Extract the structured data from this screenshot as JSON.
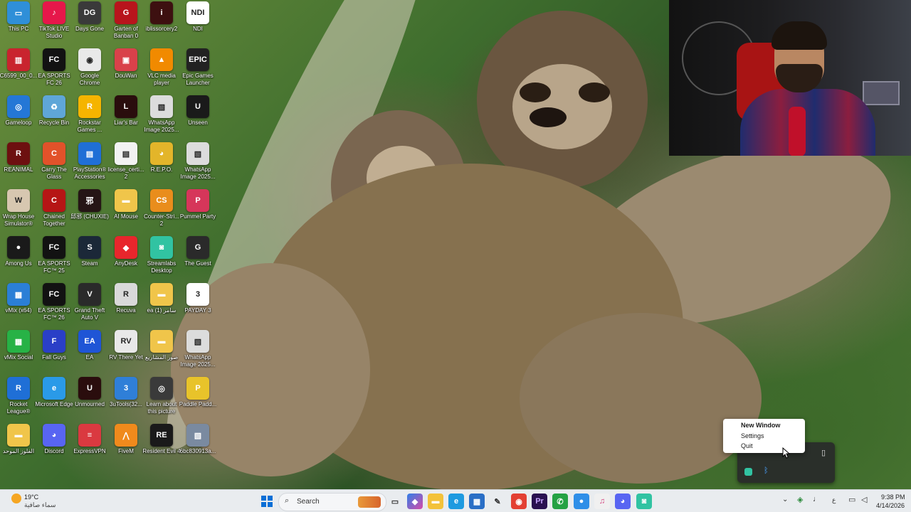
{
  "desktop": {
    "icons": [
      {
        "label": "This PC",
        "color": "#2f8fd8",
        "glyph": "▭",
        "icon": "pc-icon"
      },
      {
        "label": "TikTok LIVE Studio",
        "color": "#e6174a",
        "glyph": "♪",
        "icon": "tiktok-icon"
      },
      {
        "label": "Days Gone",
        "color": "#3a3a3a",
        "glyph": "DG",
        "icon": "game-icon"
      },
      {
        "label": "Garten of Banban 0",
        "color": "#b8141c",
        "glyph": "G",
        "icon": "game-icon"
      },
      {
        "label": "iblissorcery2",
        "color": "#3d1010",
        "glyph": "i",
        "icon": "game-icon"
      },
      {
        "label": "NDI",
        "color": "#ffffff",
        "glyph": "NDI",
        "icon": "ndi-icon"
      },
      {
        "label": "C6599_00_0...",
        "color": "#c9242e",
        "glyph": "▥",
        "icon": "file-icon"
      },
      {
        "label": "EA SPORTS FC 26",
        "color": "#121212",
        "glyph": "FC",
        "icon": "game-icon"
      },
      {
        "label": "Google Chrome",
        "color": "#e9e9e9",
        "glyph": "◉",
        "icon": "chrome-icon"
      },
      {
        "label": "DouWan",
        "color": "#d9414a",
        "glyph": "▣",
        "icon": "app-icon"
      },
      {
        "label": "VLC media player",
        "color": "#f18a00",
        "glyph": "▲",
        "icon": "vlc-icon"
      },
      {
        "label": "Epic Games Launcher",
        "color": "#222222",
        "glyph": "EPIC",
        "icon": "epic-icon"
      },
      {
        "label": "Gameloop",
        "color": "#2477d6",
        "glyph": "◎",
        "icon": "app-icon"
      },
      {
        "label": "Recycle Bin",
        "color": "#5fa6d8",
        "glyph": "♻",
        "icon": "recycle-bin-icon"
      },
      {
        "label": "Rockstar Games ...",
        "color": "#f5b400",
        "glyph": "R",
        "icon": "rockstar-icon"
      },
      {
        "label": "Liar's Bar",
        "color": "#2a0d0d",
        "glyph": "L",
        "icon": "game-icon"
      },
      {
        "label": "WhatsApp Image 2025...",
        "color": "#dcdcdc",
        "glyph": "▧",
        "icon": "image-icon"
      },
      {
        "label": "Unseen",
        "color": "#1a1a1a",
        "glyph": "U",
        "icon": "app-icon"
      },
      {
        "label": "REANIMAL",
        "color": "#6d1010",
        "glyph": "R",
        "icon": "game-icon"
      },
      {
        "label": "Carry The Glass",
        "color": "#e2522a",
        "glyph": "C",
        "icon": "game-icon"
      },
      {
        "label": "PlayStation® Accessories",
        "color": "#1f6fd6",
        "glyph": "▤",
        "icon": "playstation-icon"
      },
      {
        "label": "license_certi... 2",
        "color": "#f2f2f2",
        "glyph": "▤",
        "icon": "document-icon"
      },
      {
        "label": "R.E.P.O.",
        "color": "#e3b52a",
        "glyph": "◕",
        "icon": "game-icon"
      },
      {
        "label": "WhatsApp Image 2025...",
        "color": "#dcdcdc",
        "glyph": "▧",
        "icon": "image-icon"
      },
      {
        "label": "Wrap House Simulator®",
        "color": "#d7c7b0",
        "glyph": "W",
        "icon": "game-icon"
      },
      {
        "label": "Chained Together",
        "color": "#b61515",
        "glyph": "C",
        "icon": "game-icon"
      },
      {
        "label": "邱邪 (CHUXIE)",
        "color": "#251515",
        "glyph": "邪",
        "icon": "game-icon"
      },
      {
        "label": "AI Mouse",
        "color": "#f0c54a",
        "glyph": "▬",
        "icon": "folder-icon"
      },
      {
        "label": "Counter-Stri... 2",
        "color": "#e98d1c",
        "glyph": "CS",
        "icon": "game-icon"
      },
      {
        "label": "Pummel Party",
        "color": "#d6365a",
        "glyph": "P",
        "icon": "game-icon"
      },
      {
        "label": "Among Us",
        "color": "#1a1a1a",
        "glyph": "●",
        "icon": "game-icon"
      },
      {
        "label": "EA SPORTS FC™ 25",
        "color": "#121212",
        "glyph": "FC",
        "icon": "game-icon"
      },
      {
        "label": "Steam",
        "color": "#1b2838",
        "glyph": "S",
        "icon": "steam-icon"
      },
      {
        "label": "AnyDesk",
        "color": "#e8262c",
        "glyph": "◆",
        "icon": "anydesk-icon"
      },
      {
        "label": "Streamlabs Desktop",
        "color": "#31c3a2",
        "glyph": "◙",
        "icon": "streamlabs-icon"
      },
      {
        "label": "The Guest",
        "color": "#2a2a2a",
        "glyph": "G",
        "icon": "game-icon"
      },
      {
        "label": "vMix (x64)",
        "color": "#2b7fd6",
        "glyph": "▦",
        "icon": "vmix-icon"
      },
      {
        "label": "EA SPORTS FC™ 26",
        "color": "#121212",
        "glyph": "FC",
        "icon": "game-icon"
      },
      {
        "label": "Grand Theft Auto V",
        "color": "#2a2a2a",
        "glyph": "V",
        "icon": "game-icon"
      },
      {
        "label": "Recuva",
        "color": "#d9d9d9",
        "glyph": "R",
        "icon": "app-icon"
      },
      {
        "label": "ea سامر (1)",
        "color": "#f0c54a",
        "glyph": "▬",
        "icon": "folder-icon"
      },
      {
        "label": "PAYDAY 3",
        "color": "#ffffff",
        "glyph": "3",
        "icon": "game-icon"
      },
      {
        "label": "vMix Social",
        "color": "#27b246",
        "glyph": "▦",
        "icon": "vmix-icon"
      },
      {
        "label": "Fall Guys",
        "color": "#2a3fc7",
        "glyph": "F",
        "icon": "game-icon"
      },
      {
        "label": "EA",
        "color": "#1f55d6",
        "glyph": "EA",
        "icon": "ea-icon"
      },
      {
        "label": "RV There Yet",
        "color": "#e8e8e8",
        "glyph": "RV",
        "icon": "game-icon"
      },
      {
        "label": "صور المشاريع",
        "color": "#f0c54a",
        "glyph": "▬",
        "icon": "folder-icon"
      },
      {
        "label": "WhatsApp Image 2025...",
        "color": "#dcdcdc",
        "glyph": "▧",
        "icon": "image-icon"
      },
      {
        "label": "Rocket League®",
        "color": "#1f6fd6",
        "glyph": "R",
        "icon": "game-icon"
      },
      {
        "label": "Microsoft Edge",
        "color": "#2a9ae8",
        "glyph": "e",
        "icon": "edge-icon"
      },
      {
        "label": "Unmourned",
        "color": "#2a0d0d",
        "glyph": "U",
        "icon": "game-icon"
      },
      {
        "label": "3uTools(32...",
        "color": "#2f7fd8",
        "glyph": "3",
        "icon": "app-icon"
      },
      {
        "label": "Learn about this picture",
        "color": "#3a3a3a",
        "glyph": "◎",
        "icon": "info-icon"
      },
      {
        "label": "Paddle Padd...",
        "color": "#e8c32a",
        "glyph": "P",
        "icon": "game-icon"
      },
      {
        "label": "الفلوز الموحد",
        "color": "#f0c54a",
        "glyph": "▬",
        "icon": "folder-icon"
      },
      {
        "label": "Discord",
        "color": "#5865f2",
        "glyph": "◕",
        "icon": "discord-icon"
      },
      {
        "label": "ExpressVPN",
        "color": "#da3940",
        "glyph": "≡",
        "icon": "vpn-icon"
      },
      {
        "label": "FiveM",
        "color": "#f08a1c",
        "glyph": "⋀",
        "icon": "fivem-icon"
      },
      {
        "label": "Resident Evil 4",
        "color": "#1a1a1a",
        "glyph": "RE",
        "icon": "game-icon"
      },
      {
        "label": "6bc830913a...",
        "color": "#7a8aa0",
        "glyph": "▧",
        "icon": "image-icon"
      }
    ]
  },
  "context_menu": {
    "items": [
      "New Window",
      "Settings",
      "Quit"
    ]
  },
  "taskbar": {
    "weather_temp": "19°C",
    "weather_desc": "سماء صافية",
    "search_label": "Search",
    "time": "9:38 PM",
    "date": "4/14/2026",
    "lang": "ع",
    "bg": "#e9ecef"
  }
}
